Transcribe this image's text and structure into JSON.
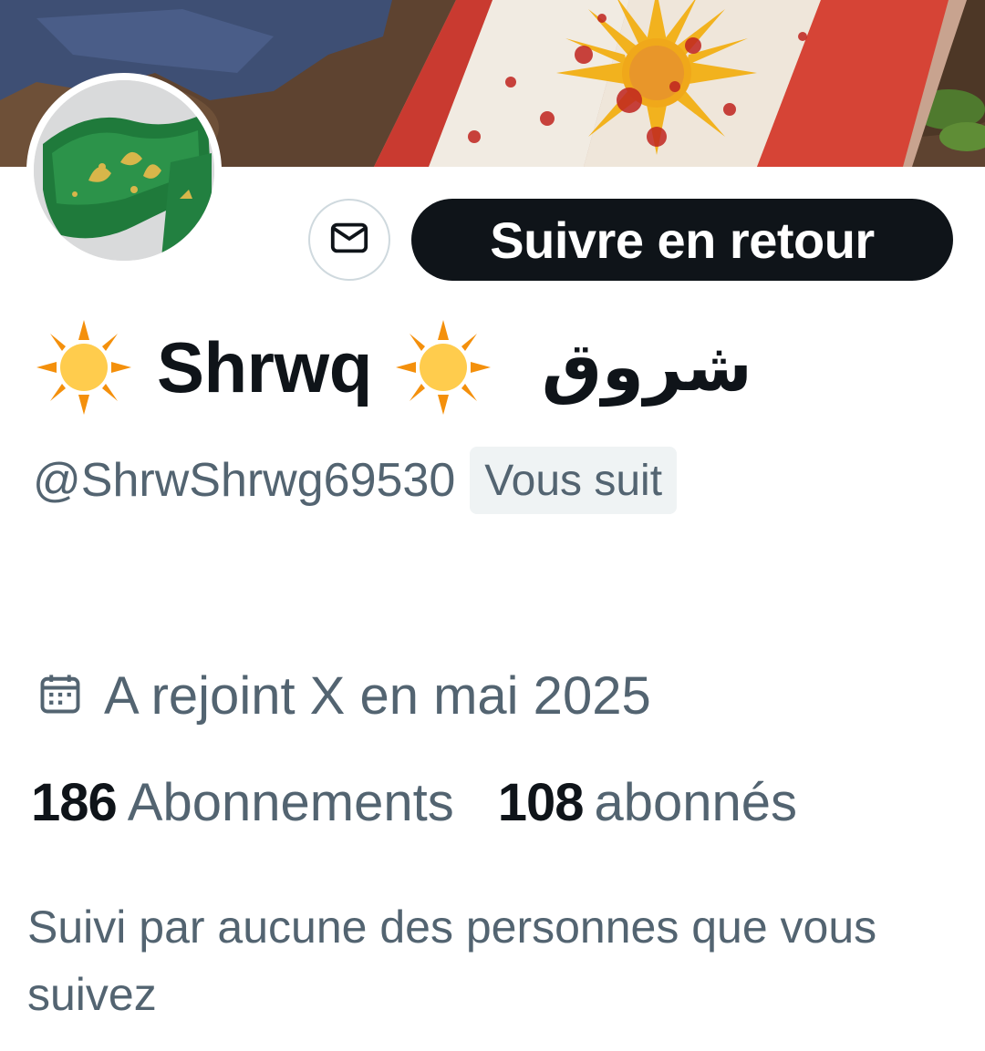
{
  "profile": {
    "display_name": "Shrwq",
    "arabic_name": "شروق",
    "name_emoji": "sun-emoji",
    "handle": "@ShrwShrwg69530",
    "follows_you_badge": "Vous suit",
    "joined": "A rejoint X en mai 2025"
  },
  "actions": {
    "message_icon": "envelope-icon",
    "follow_back_label": "Suivre en retour"
  },
  "stats": {
    "following_count": "186",
    "following_label": "Abonnements",
    "followers_count": "108",
    "followers_label": "abonnés"
  },
  "followed_by_text": "Suivi par aucune des personnes que vous suivez",
  "colors": {
    "primary_text": "#0f1419",
    "secondary_text": "#536471",
    "button_bg": "#0f1419",
    "badge_bg": "#eff3f4",
    "border": "#cfd9de"
  }
}
